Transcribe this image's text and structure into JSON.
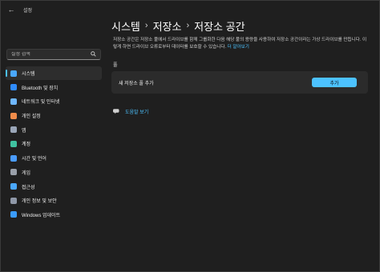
{
  "window": {
    "title": "설정",
    "back_glyph": "←"
  },
  "search": {
    "placeholder": "설정 검색"
  },
  "sidebar": {
    "items": [
      {
        "label": "시스템",
        "icon": "system-icon",
        "color": "#4aa8ff"
      },
      {
        "label": "Bluetooth 및 장치",
        "icon": "bluetooth-icon",
        "color": "#2f8cff"
      },
      {
        "label": "네트워크 및 인터넷",
        "icon": "network-icon",
        "color": "#6fb7ff"
      },
      {
        "label": "개인 설정",
        "icon": "personalization-icon",
        "color": "#f08c4a"
      },
      {
        "label": "앱",
        "icon": "apps-icon",
        "color": "#9aa6b8"
      },
      {
        "label": "계정",
        "icon": "accounts-icon",
        "color": "#3fc1a0"
      },
      {
        "label": "시간 및 언어",
        "icon": "time-language-icon",
        "color": "#4a9cff"
      },
      {
        "label": "게임",
        "icon": "gaming-icon",
        "color": "#9aa0aa"
      },
      {
        "label": "접근성",
        "icon": "accessibility-icon",
        "color": "#4aa8ff"
      },
      {
        "label": "개인 정보 및 보안",
        "icon": "shield-icon",
        "color": "#8f98a8"
      },
      {
        "label": "Windows 업데이트",
        "icon": "windows-update-icon",
        "color": "#3a9cff"
      }
    ],
    "active_index": 0
  },
  "breadcrumb": {
    "items": [
      "시스템",
      "저장소",
      "저장소 공간"
    ],
    "separator": "›"
  },
  "description": {
    "text": "저장소 공간은 저장소 풀에서 드라이브를 함께 그룹화한 다음 해당 풀의 용량을 사용하여 저장소 공간이라는 가상 드라이브를 만듭니다. 이렇게 하면 드라이브 오류로부터 데이터를 보호할 수 있습니다.",
    "link": "더 알아보기"
  },
  "pool": {
    "label": "풀",
    "add_row_label": "새 저장소 풀 추가",
    "add_button": "추가"
  },
  "help": {
    "label": "도움말 보기"
  },
  "accent": "#4cc2ff"
}
